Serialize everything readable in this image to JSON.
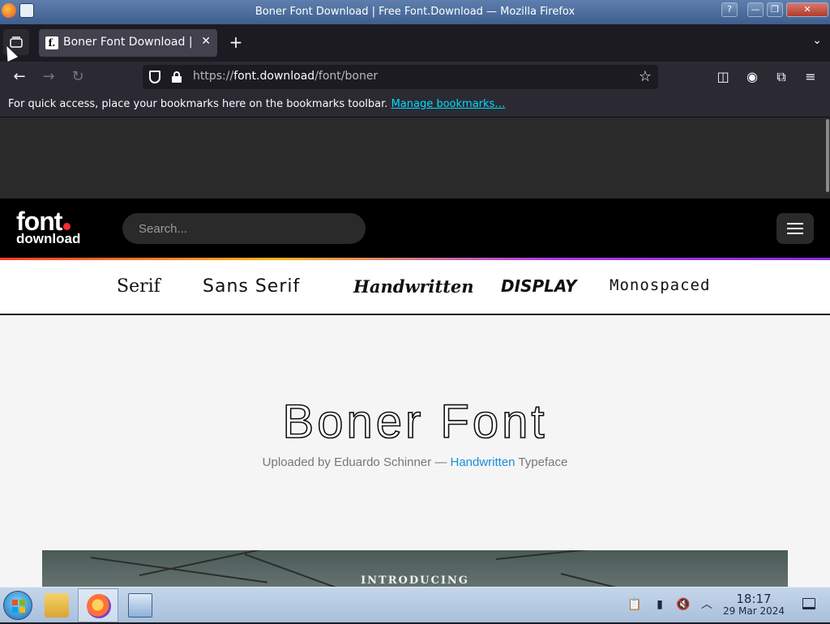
{
  "window": {
    "title": "Boner Font Download | Free Font.Download — Mozilla Firefox",
    "help_label": "?",
    "min_label": "—",
    "max_label": "❐",
    "close_label": "✕"
  },
  "tabs": {
    "active_title": "Boner Font Download | Free Font.Download",
    "favicon_letter": "f.",
    "close_label": "✕",
    "new_tab_label": "+",
    "overflow_label": "⌄"
  },
  "navbar": {
    "back_label": "←",
    "forward_label": "→",
    "reload_label": "↻",
    "url_scheme": "https://",
    "url_host": "font.download",
    "url_path": "/font/boner",
    "star_label": "☆",
    "pocket_label": "◫",
    "account_label": "◉",
    "extensions_label": "⧉",
    "menu_label": "≡"
  },
  "bookmarks": {
    "message": "For quick access, place your bookmarks here on the bookmarks toolbar.",
    "manage_link": "Manage bookmarks…"
  },
  "site": {
    "logo_line1": "font",
    "logo_line2": "download",
    "search_placeholder": "Search...",
    "categories": [
      "Serif",
      "Sans Serif",
      "Handwritten",
      "DISPLAY",
      "Monospaced"
    ],
    "font_title": "Boner Font",
    "subtitle_prefix": "Uploaded by Eduardo Schinner — ",
    "subtitle_link": "Handwritten",
    "subtitle_suffix": " Typeface",
    "preview_text": "INTRODUCING"
  },
  "taskbar": {
    "time": "18:17",
    "date": "29 Mar 2024",
    "tray_icons": [
      "clipboard-icon",
      "battery-icon",
      "volume-muted-icon",
      "tray-expand-icon"
    ]
  },
  "colors": {
    "accent_link": "#1a8dd6",
    "bookmarks_link": "#00ddff",
    "logo_dot": "#ff2d2d"
  }
}
